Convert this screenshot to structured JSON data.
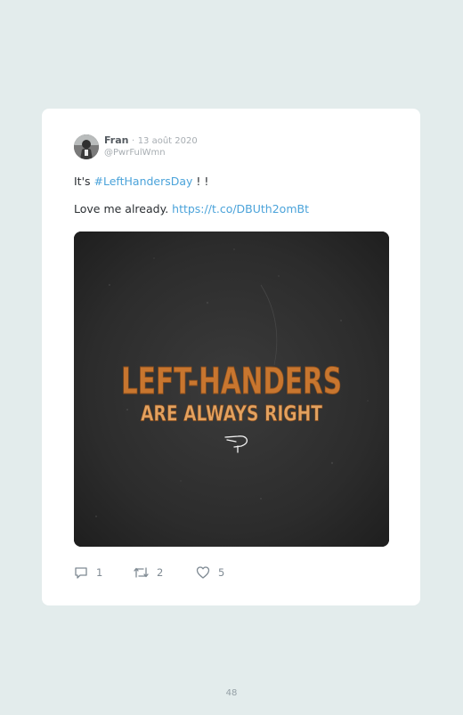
{
  "tweet": {
    "author_name": "Fran",
    "separator": "·",
    "date": "13 août 2020",
    "handle": "@PwrFulWmn",
    "line1_prefix": "It's ",
    "hashtag": "#LeftHandersDay",
    "line1_suffix": " ! !",
    "line2_prefix": "Love me already. ",
    "link": "https://t.co/DBUth2omBt"
  },
  "image": {
    "text_line1": "LEFT-HANDERS",
    "text_line2": "ARE ALWAYS RIGHT"
  },
  "stats": {
    "replies": "1",
    "retweets": "2",
    "likes": "5"
  },
  "page": {
    "number": "48"
  },
  "colors": {
    "background": "#e3ecec",
    "link": "#4ba3da",
    "image_text": "#c8762f"
  }
}
